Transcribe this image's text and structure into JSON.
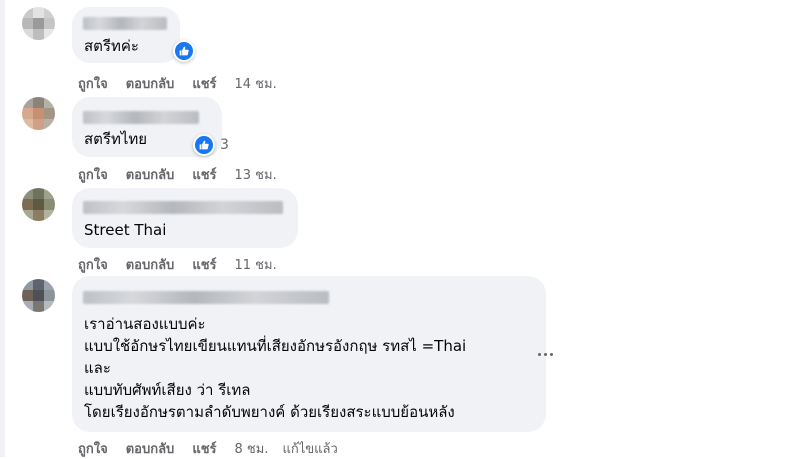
{
  "actions": {
    "like": "ถูกใจ",
    "reply": "ตอบกลับ",
    "share": "แชร์"
  },
  "colors": {
    "bubble": "#f0f2f5",
    "like": "#1877f2",
    "meta": "#65676b"
  },
  "comments": [
    {
      "text_lines": [
        "สตรีทค่ะ"
      ],
      "reaction": {
        "icon": "like-icon",
        "count": ""
      },
      "time": "14 ชม."
    },
    {
      "text_lines": [
        "สตรีทไทย"
      ],
      "reaction": {
        "icon": "like-icon",
        "count": "3"
      },
      "time": "13 ชม."
    },
    {
      "text_lines": [
        "Street Thai"
      ],
      "time": "11 ชม."
    },
    {
      "text_lines": [
        "เราอ่านสองแบบค่ะ",
        "แบบใช้อักษรไทยเขียนแทนที่เสียงอักษรอังกฤษ รทสไ =Thai",
        "และ",
        "แบบทับศัพท์เสียง ว่า รีเทล",
        "โดยเรียงอักษรตามลำดับพยางค์ ด้วยเรียงสระแบบย้อนหลัง"
      ],
      "time": "8 ชม.",
      "edited": "แก้ไขแล้ว",
      "more_icon": "more-options-icon"
    }
  ]
}
